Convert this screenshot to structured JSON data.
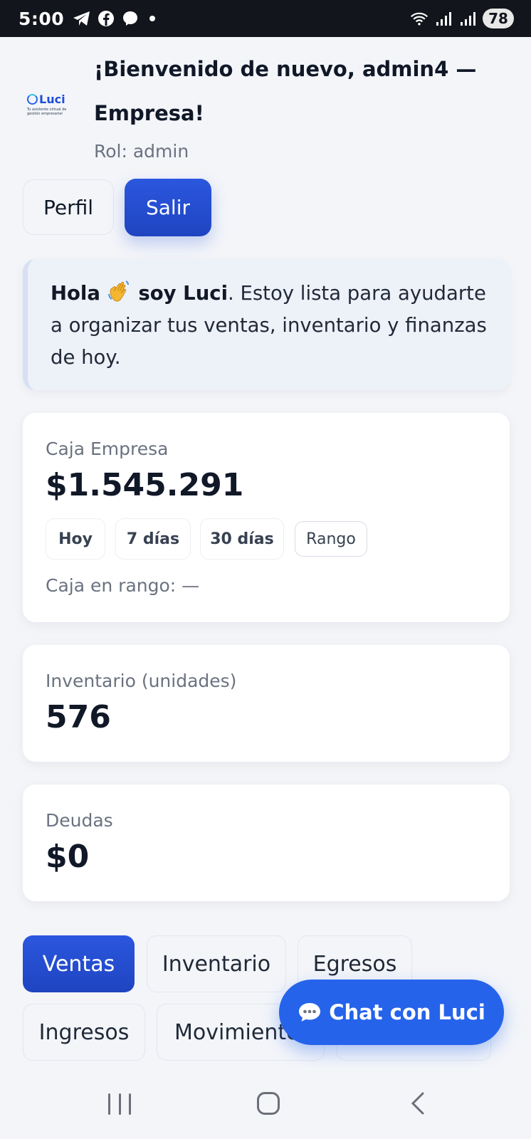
{
  "status_bar": {
    "time": "5:00",
    "left_icons": [
      "telegram-icon",
      "facebook-icon",
      "messenger-icon",
      "dot-icon"
    ],
    "right_icons": [
      "wifi-icon",
      "signal-icon",
      "signal-icon"
    ],
    "battery": "78"
  },
  "header": {
    "logo_text": "Luci",
    "logo_tagline": "Tu asistente virtual de gestión empresarial",
    "welcome": "¡Bienvenido de nuevo, admin4 — Empresa!",
    "role": "Rol: admin",
    "profile_label": "Perfil",
    "logout_label": "Salir"
  },
  "greeting": {
    "hello": "Hola",
    "name": "soy Luci",
    "rest": ". Estoy lista para ayudarte a organizar tus ventas, inventario y finanzas de hoy."
  },
  "cash": {
    "label": "Caja Empresa",
    "value": "$1.545.291",
    "ranges": [
      "Hoy",
      "7 días",
      "30 días",
      "Rango"
    ],
    "range_text": "Caja en rango: —"
  },
  "inventory": {
    "label": "Inventario (unidades)",
    "value": "576"
  },
  "debts": {
    "label": "Deudas",
    "value": "$0"
  },
  "tabs": [
    "Ventas",
    "Inventario",
    "Egresos",
    "Ingresos",
    "Movimientos"
  ],
  "chat": {
    "label": "Chat con Luci"
  },
  "colors": {
    "primary": "#1f44c0",
    "chat": "#2563eb",
    "background": "#f3f5f9"
  }
}
